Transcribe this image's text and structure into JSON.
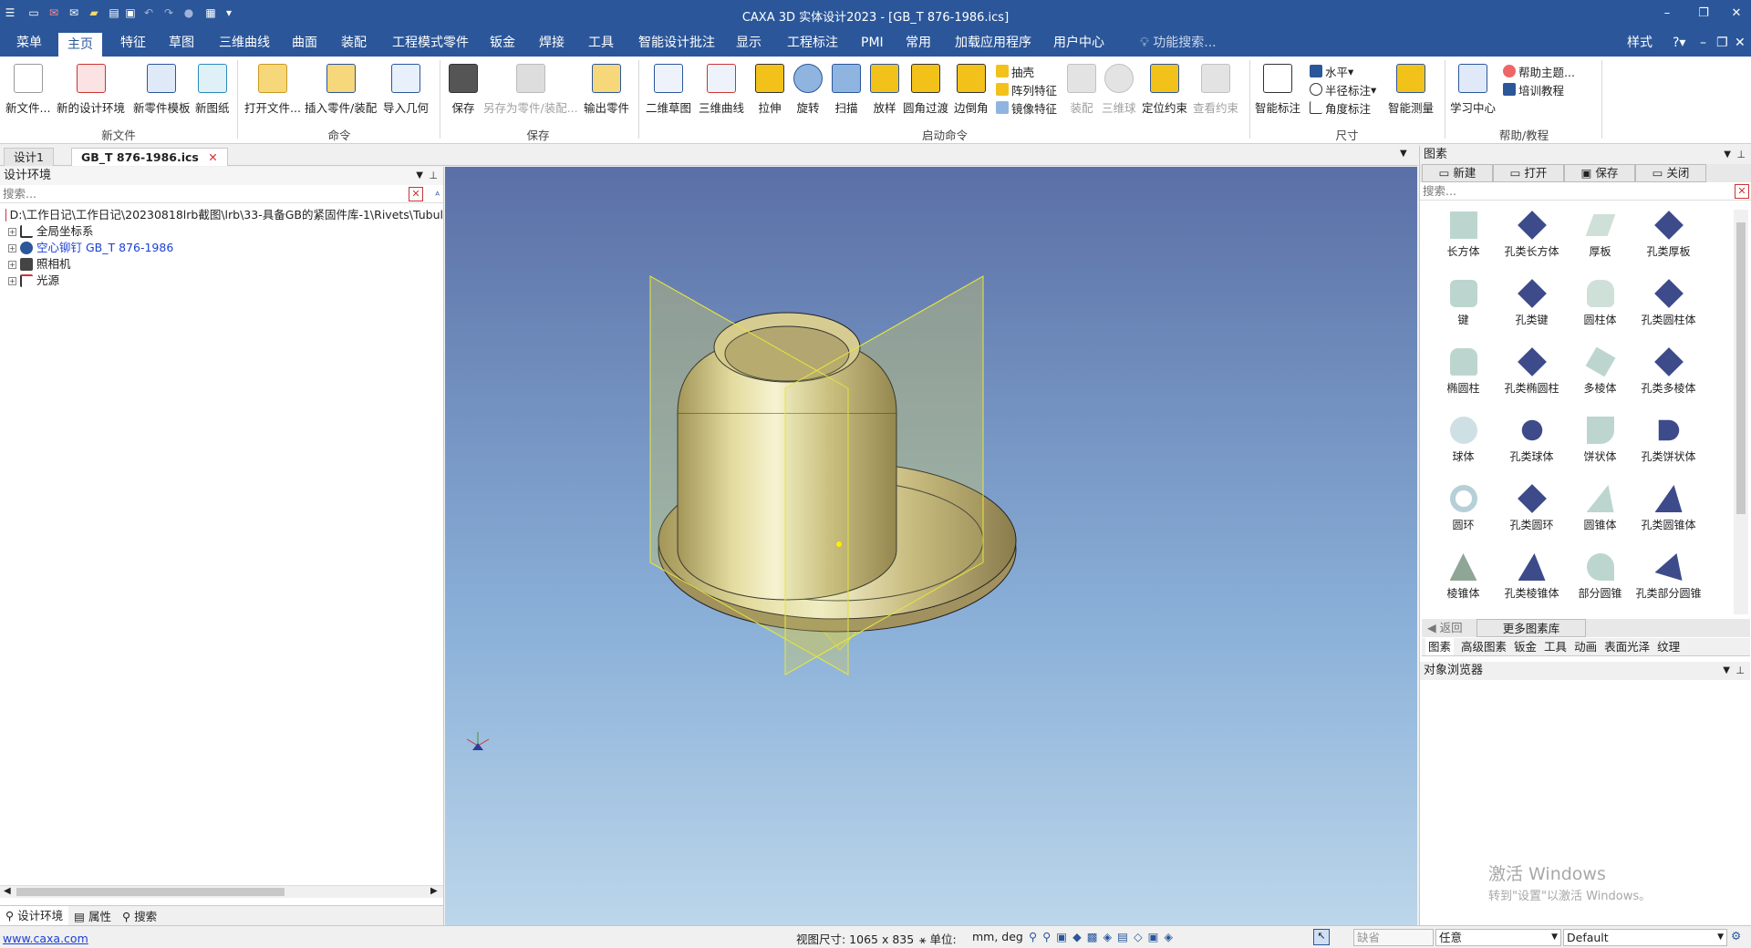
{
  "app": {
    "title": "CAXA 3D 实体设计2023 - [GB_T 876-1986.ics]"
  },
  "menu": {
    "tabs": [
      "菜单",
      "主页",
      "特征",
      "草图",
      "三维曲线",
      "曲面",
      "装配",
      "工程模式零件",
      "钣金",
      "焊接",
      "工具",
      "智能设计批注",
      "显示",
      "工程标注",
      "PMI",
      "常用",
      "加载应用程序",
      "用户中心"
    ],
    "search": "功能搜索...",
    "style": "样式"
  },
  "ribbon": {
    "new_file": {
      "label": "新文件",
      "buttons": [
        "新文件...",
        "新的设计环境",
        "新零件模板",
        "新图纸"
      ]
    },
    "command": {
      "label": "命令",
      "buttons": [
        "打开文件...",
        "插入零件/装配",
        "导入几何"
      ]
    },
    "save": {
      "label": "保存",
      "buttons": [
        "保存",
        "另存为零件/装配...",
        "输出零件"
      ]
    },
    "launch": {
      "label": "启动命令",
      "buttons": [
        "二维草图",
        "三维曲线",
        "拉伸",
        "旋转",
        "扫描",
        "放样",
        "圆角过渡",
        "边倒角"
      ],
      "small": [
        "抽壳",
        "阵列特征",
        "镜像特征"
      ],
      "disabled": [
        "装配",
        "三维球",
        "定位约束",
        "查看约束"
      ]
    },
    "dim": {
      "label": "尺寸",
      "big": "智能标注",
      "small": [
        "水平",
        "半径标注",
        "角度标注"
      ],
      "measure": "智能测量"
    },
    "help": {
      "label": "帮助/教程",
      "big": "学习中心",
      "small": [
        "帮助主题...",
        "培训教程"
      ]
    }
  },
  "doc_tabs": [
    "设计1",
    "GB_T 876-1986.ics"
  ],
  "left": {
    "title": "设计环境",
    "search": "搜索...",
    "tree": [
      "D:\\工作日记\\工作日记\\20230818lrb截图\\lrb\\33-具备GB的紧固件库-1\\Rivets\\Tubul",
      "全局坐标系",
      "空心铆钉 GB_T 876-1986",
      "照相机",
      "光源"
    ],
    "bottom_tabs": [
      "设计环境",
      "属性",
      "搜索"
    ]
  },
  "right": {
    "title": "图素",
    "buttons": [
      "新建",
      "打开",
      "保存",
      "关闭"
    ],
    "search": "搜索...",
    "items": [
      "长方体",
      "孔类长方体",
      "厚板",
      "孔类厚板",
      "键",
      "孔类键",
      "圆柱体",
      "孔类圆柱体",
      "椭圆柱",
      "孔类椭圆柱",
      "多棱体",
      "孔类多棱体",
      "球体",
      "孔类球体",
      "饼状体",
      "孔类饼状体",
      "圆环",
      "孔类圆环",
      "圆锥体",
      "孔类圆锥体",
      "棱锥体",
      "孔类棱锥体",
      "部分圆锥",
      "孔类部分圆锥"
    ],
    "back": "返回",
    "more": "更多图素库",
    "tabs": [
      "图素",
      "高级图素",
      "钣金",
      "工具",
      "动画",
      "表面光泽",
      "纹理"
    ],
    "browser_title": "对象浏览器",
    "watermark1": "激活 Windows",
    "watermark2": "转到\"设置\"以激活 Windows。"
  },
  "status": {
    "link": "www.caxa.com",
    "view_size": "视图尺寸: 1065 x 835",
    "unit_label": "单位:",
    "unit": "mm, deg",
    "field1": "缺省",
    "field2": "任意",
    "field3": "Default"
  }
}
